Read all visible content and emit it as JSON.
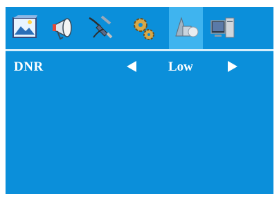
{
  "tabs": [
    {
      "icon": "picture-icon"
    },
    {
      "icon": "megaphone-icon"
    },
    {
      "icon": "cable-connector-icon"
    },
    {
      "icon": "gears-icon"
    },
    {
      "icon": "3d-shapes-icon",
      "active": true
    },
    {
      "icon": "computer-icon"
    }
  ],
  "setting": {
    "label": "DNR",
    "value": "Low"
  },
  "colors": {
    "background": "#0b8fda",
    "active_tab": "#3fb4ef",
    "text": "#ffffff"
  }
}
